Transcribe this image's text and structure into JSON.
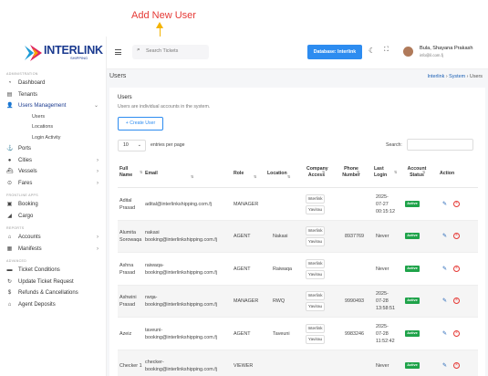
{
  "annotation": {
    "label": "Add New User"
  },
  "brand": {
    "name": "INTERLINK",
    "sub": "SHIPPING"
  },
  "sidebar": {
    "sections": [
      {
        "title": "ADMINISTRATION",
        "items": [
          {
            "label": "Dashboard",
            "icon": "dashboard-icon"
          },
          {
            "label": "Tenants",
            "icon": "tenants-icon"
          },
          {
            "label": "Users Management",
            "icon": "users-icon",
            "chevron": "⌄",
            "active": true,
            "children": [
              "Users",
              "Locations",
              "Login Activity"
            ]
          },
          {
            "label": "Ports",
            "icon": "port-icon"
          },
          {
            "label": "Cities",
            "icon": "city-icon",
            "chevron": "›"
          },
          {
            "label": "Vessels",
            "icon": "vessel-icon",
            "chevron": "›"
          },
          {
            "label": "Fares",
            "icon": "fares-icon",
            "chevron": "›"
          }
        ]
      },
      {
        "title": "FRONTLINE APPS",
        "items": [
          {
            "label": "Booking",
            "icon": "booking-icon"
          },
          {
            "label": "Cargo",
            "icon": "cargo-icon"
          }
        ]
      },
      {
        "title": "REPORTS",
        "items": [
          {
            "label": "Accounts",
            "icon": "accounts-icon",
            "chevron": "›"
          },
          {
            "label": "Manifests",
            "icon": "manifests-icon",
            "chevron": "›"
          }
        ]
      },
      {
        "title": "ADVANCED",
        "items": [
          {
            "label": "Ticket Conditions",
            "icon": "ticket-icon"
          },
          {
            "label": "Update Ticket Request",
            "icon": "refresh-icon"
          },
          {
            "label": "Refunds & Cancellations",
            "icon": "refund-icon"
          },
          {
            "label": "Agent Deposits",
            "icon": "deposit-icon"
          }
        ]
      }
    ]
  },
  "topbar": {
    "search_placeholder": "Search Tickets",
    "database_label": "Database: Interlink",
    "user_name": "Bula, Shayana Prakash",
    "user_email": "info@il.com.fj"
  },
  "page": {
    "title": "Users",
    "breadcrumb": [
      "Interlink",
      "System",
      "Users"
    ],
    "card_title": "Users",
    "card_subtitle": "Users are individual accounts in the system.",
    "create_label": "+ Create User",
    "page_length": "10",
    "entries_label": "entries per page",
    "search_label": "Search:"
  },
  "table": {
    "columns": [
      "Full Name",
      "Email",
      "Role",
      "Location",
      "Company Access",
      "Phone Number",
      "Last Login",
      "Account Status",
      "Action"
    ],
    "rows": [
      {
        "name": [
          "Adital",
          "Prasad"
        ],
        "email": [
          "adital@interlinkshipping.com.fj"
        ],
        "role": "MANAGER",
        "location": "",
        "access": [
          "Interlink",
          "Yavirau"
        ],
        "phone": "",
        "login": [
          "2025-",
          "07-27",
          "00:15:12"
        ],
        "status": "Active"
      },
      {
        "name": [
          "Alumita",
          "Sorowaqa"
        ],
        "email": [
          "nakasi",
          "booking@interlinkshipping.com.fj"
        ],
        "role": "AGENT",
        "location": "Nakasi",
        "access": [
          "Interlink",
          "Yavirau"
        ],
        "phone": "8937769",
        "login": [
          "Never"
        ],
        "status": "Active"
      },
      {
        "name": [
          "Ashna",
          "Prasad"
        ],
        "email": [
          "raiwaqa-",
          "booking@interlinkshipping.com.fj"
        ],
        "role": "AGENT",
        "location": "Raiwaqa",
        "access": [
          "Interlink",
          "Yavirau"
        ],
        "phone": "",
        "login": [
          "Never"
        ],
        "status": "Active"
      },
      {
        "name": [
          "Ashwini",
          "Prasad"
        ],
        "email": [
          "rwqa-",
          "booking@interlinkshipping.com.fj"
        ],
        "role": "MANAGER",
        "location": "RWQ",
        "access": [
          "Interlink",
          "Yavirau"
        ],
        "phone": "9990493",
        "login": [
          "2025-",
          "07-28",
          "13:58:51"
        ],
        "status": "Active"
      },
      {
        "name": [
          "Azeiz"
        ],
        "email": [
          "taveuni-",
          "booking@interlinkshipping.com.fj"
        ],
        "role": "AGENT",
        "location": "Taveuni",
        "access": [
          "Interlink",
          "Yavirau"
        ],
        "phone": "9983246",
        "login": [
          "2025-",
          "07-28",
          "11:52:42"
        ],
        "status": "Active"
      },
      {
        "name": [
          "Checker 1"
        ],
        "email": [
          "checker-",
          "booking@interlinkshipping.com.fj"
        ],
        "role": "VIEWER",
        "location": "",
        "access": [],
        "phone": "",
        "login": [
          "Never"
        ],
        "status": "Active"
      }
    ]
  },
  "colors": {
    "primary": "#2d8cf0",
    "brand": "#1a3a8f",
    "active": "#1fa34a",
    "danger": "#e53935",
    "annotation": "#f4b400"
  }
}
